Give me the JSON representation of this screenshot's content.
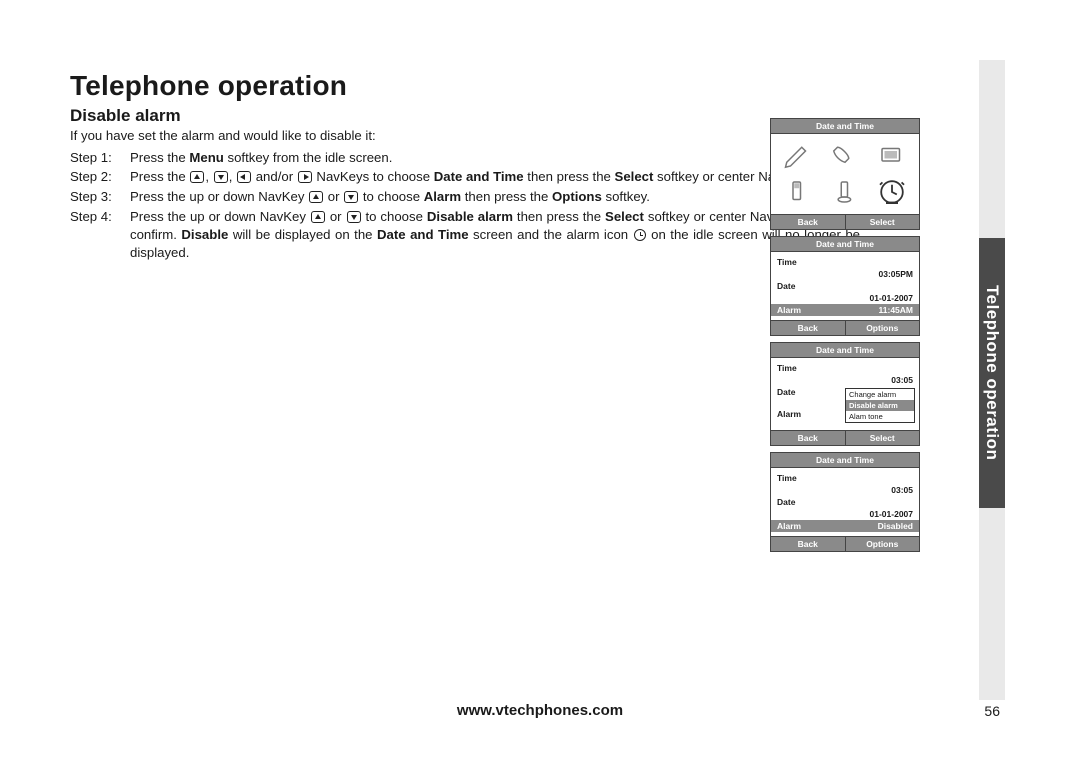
{
  "title": "Telephone operation",
  "subtitle": "Disable alarm",
  "intro": "If you have set the alarm and would like to disable it:",
  "steps": [
    {
      "label": "Step 1:",
      "html": "Press the <b>Menu</b> softkey from the idle screen."
    },
    {
      "label": "Step 2:",
      "html": "Press the <span class='icon-key up' data-name='navkey-up-icon' data-interactable='false'></span>, <span class='icon-key down' data-name='navkey-down-icon' data-interactable='false'></span>, <span class='icon-key left' data-name='navkey-left-icon' data-interactable='false'></span> and/or <span class='icon-key right' data-name='navkey-right-icon' data-interactable='false'></span> NavKeys to choose <b>Date and Time</b> then press the <b>Select</b> softkey or center NavKey/<b>SEL</b>/<span class='icon-key sel' data-name='navkey-sel-icon' data-interactable='false'></span>."
    },
    {
      "label": "Step 3:",
      "html": "Press the up or down NavKey <span class='icon-key up' data-name='navkey-up-icon' data-interactable='false'></span> or <span class='icon-key down' data-name='navkey-down-icon' data-interactable='false'></span> to choose <b>Alarm</b> then press the <b>Options</b> softkey."
    },
    {
      "label": "Step 4:",
      "html": "Press the up or down NavKey <span class='icon-key up' data-name='navkey-up-icon' data-interactable='false'></span> or <span class='icon-key down' data-name='navkey-down-icon' data-interactable='false'></span> to choose <b>Disable alarm</b> then press the <b>Select</b> softkey or center NavKey/<b>SEL</b>/<span class='icon-key sel' data-name='navkey-sel-icon' data-interactable='false'></span> to confirm. <b>Disable</b> will be displayed on the <b>Date and Time</b> screen and the alarm icon <span class='icon-clock' data-name='alarm-clock-icon' data-interactable='false'></span> on the idle screen will no longer be displayed."
    }
  ],
  "side_tab": "Telephone operation",
  "footer": {
    "url": "www.vtechphones.com",
    "page": "56"
  },
  "screens": {
    "s1": {
      "header": "Date and Time",
      "left": "Back",
      "right": "Select"
    },
    "s2": {
      "header": "Date and Time",
      "rows": {
        "time_label": "Time",
        "time_value": "03:05PM",
        "date_label": "Date",
        "date_value": "01-01-2007",
        "alarm_label": "Alarm",
        "alarm_value": "11:45AM"
      },
      "left": "Back",
      "right": "Options"
    },
    "s3": {
      "header": "Date and Time",
      "rows": {
        "time_label": "Time",
        "time_value": "03:05",
        "date_label": "Date",
        "alarm_label": "Alarm"
      },
      "popup": {
        "opt1": "Change alarm",
        "opt2": "Disable alarm",
        "opt3": "Alam tone"
      },
      "left": "Back",
      "right": "Select"
    },
    "s4": {
      "header": "Date and Time",
      "rows": {
        "time_label": "Time",
        "time_value": "03:05",
        "date_label": "Date",
        "date_value": "01-01-2007",
        "alarm_label": "Alarm",
        "alarm_value": "Disabled"
      },
      "left": "Back",
      "right": "Options"
    }
  }
}
